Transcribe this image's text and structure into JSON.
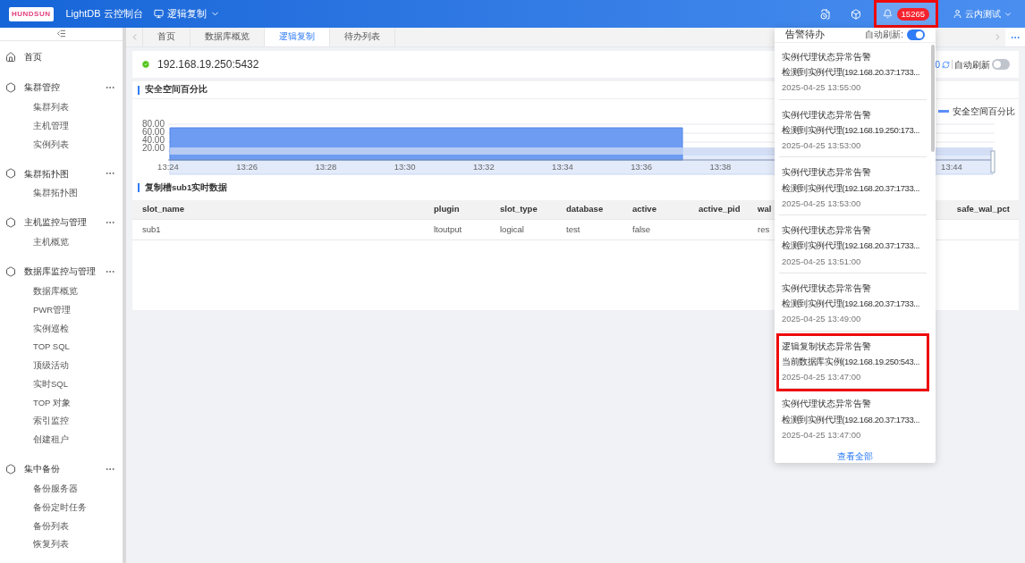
{
  "header": {
    "logo": "HUNDSUN",
    "title": "LightDB 云控制台",
    "module": "逻辑复制",
    "alert_count": "15265",
    "alert_highlighted": true,
    "user": "云内测试"
  },
  "sidebar": {
    "items": [
      {
        "label": "首页",
        "kind": "home"
      },
      {
        "label": "集群管控",
        "kind": "group",
        "children": [
          {
            "label": "集群列表"
          },
          {
            "label": "主机管理"
          },
          {
            "label": "实例列表"
          }
        ]
      },
      {
        "label": "集群拓扑图",
        "kind": "group",
        "children": [
          {
            "label": "集群拓扑图"
          }
        ]
      },
      {
        "label": "主机监控与管理",
        "kind": "group",
        "children": [
          {
            "label": "主机概览"
          }
        ]
      },
      {
        "label": "数据库监控与管理",
        "kind": "group",
        "children": [
          {
            "label": "数据库概览"
          },
          {
            "label": "PWR管理"
          },
          {
            "label": "实例巡检"
          },
          {
            "label": "TOP SQL"
          },
          {
            "label": "顶级活动"
          },
          {
            "label": "实时SQL"
          },
          {
            "label": "TOP 对象"
          },
          {
            "label": "索引监控"
          },
          {
            "label": "创建租户"
          }
        ]
      },
      {
        "label": "集中备份",
        "kind": "group",
        "children": [
          {
            "label": "备份服务器"
          },
          {
            "label": "备份定时任务"
          },
          {
            "label": "备份列表"
          },
          {
            "label": "恢复列表"
          }
        ]
      }
    ]
  },
  "tabs": [
    {
      "label": "首页",
      "selected": false
    },
    {
      "label": "数据库概览",
      "selected": false
    },
    {
      "label": "逻辑复制",
      "selected": true
    },
    {
      "label": "待办列表",
      "selected": false
    }
  ],
  "instance": {
    "address": "192.168.19.250:5432",
    "refresh_count": "0",
    "auto_refresh_label": "自动刷新",
    "auto_refresh": false
  },
  "chart_section": {
    "title": "安全空间百分比",
    "legend": "安全空间百分比",
    "y_tick_labels": [
      "80.00",
      "60.00",
      "40.00",
      "20.00"
    ],
    "x_tick_labels": [
      "13:24",
      "13:26",
      "13:28",
      "13:30",
      "13:32",
      "13:34",
      "13:36",
      "13:38"
    ],
    "x_tick_labels_right": [
      "13:44"
    ]
  },
  "table": {
    "title": "复制槽sub1实时数据",
    "columns": [
      "slot_name",
      "plugin",
      "slot_type",
      "database",
      "active",
      "active_pid",
      "wal",
      "safe_wal_pct"
    ],
    "rows": [
      [
        "sub1",
        "ltoutput",
        "logical",
        "test",
        "false",
        "",
        "res",
        ""
      ]
    ]
  },
  "alerts_popup": {
    "title": "告警待办",
    "auto_refresh_label": "自动刷新:",
    "auto_refresh": true,
    "footer_link": "查看全部",
    "items": [
      {
        "title": "实例代理状态异常告警",
        "detail": "检测到实例代理(192.168.20.37:1733...",
        "time": "2025-04-25 13:55:00",
        "highlighted": false
      },
      {
        "title": "实例代理状态异常告警",
        "detail": "检测到实例代理(192.168.19.250:173...",
        "time": "2025-04-25 13:53:00",
        "highlighted": false
      },
      {
        "title": "实例代理状态异常告警",
        "detail": "检测到实例代理(192.168.20.37:1733...",
        "time": "2025-04-25 13:53:00",
        "highlighted": false
      },
      {
        "title": "实例代理状态异常告警",
        "detail": "检测到实例代理(192.168.20.37:1733...",
        "time": "2025-04-25 13:51:00",
        "highlighted": false
      },
      {
        "title": "实例代理状态异常告警",
        "detail": "检测到实例代理(192.168.20.37:1733...",
        "time": "2025-04-25 13:49:00",
        "highlighted": false
      },
      {
        "title": "逻辑复制状态异常告警",
        "detail": "当前数据库实例(192.168.19.250:543...",
        "time": "2025-04-25 13:47:00",
        "highlighted": true
      },
      {
        "title": "实例代理状态异常告警",
        "detail": "检测到实例代理(192.168.20.37:1733...",
        "time": "2025-04-25 13:47:00",
        "highlighted": false
      }
    ]
  }
}
